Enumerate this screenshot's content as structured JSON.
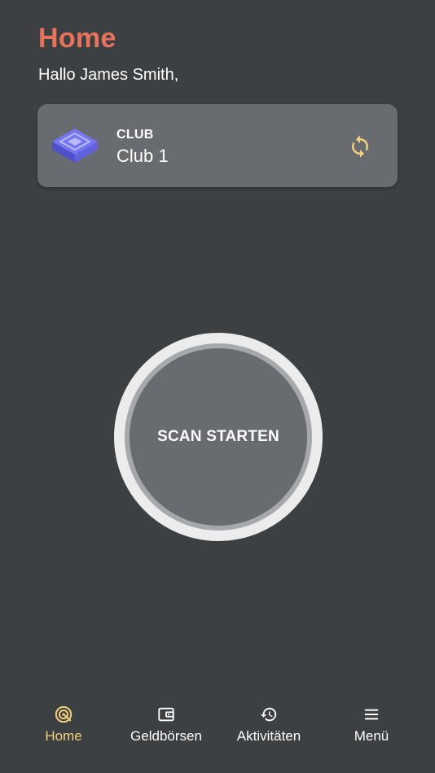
{
  "header": {
    "title": "Home",
    "greeting": "Hallo James Smith,"
  },
  "club_card": {
    "caption": "CLUB",
    "name": "Club 1",
    "logo_icon": "layered-stack-icon",
    "switch_icon": "sync-icon"
  },
  "scan": {
    "label": "SCAN STARTEN"
  },
  "bottom_nav": {
    "items": [
      {
        "label": "Home",
        "icon": "target-icon",
        "active": true
      },
      {
        "label": "Geldbörsen",
        "icon": "wallet-icon",
        "active": false
      },
      {
        "label": "Aktivitäten",
        "icon": "history-icon",
        "active": false
      },
      {
        "label": "Menü",
        "icon": "menu-icon",
        "active": false
      }
    ]
  },
  "colors": {
    "background": "#3d4043",
    "card": "#686b70",
    "title_accent": "#e8735a",
    "nav_active": "#f2d07a",
    "logo": "#6b6cf0"
  }
}
